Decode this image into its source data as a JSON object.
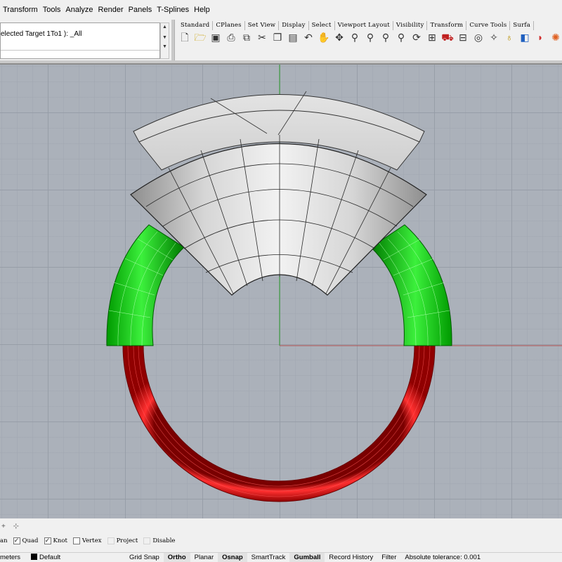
{
  "menubar": {
    "items": [
      "Transform",
      "Tools",
      "Analyze",
      "Render",
      "Panels",
      "T-Splines",
      "Help"
    ]
  },
  "command": {
    "history_text": "elected Target 1To1 ): _All"
  },
  "toolbar": {
    "tabs": [
      "Standard",
      "CPlanes",
      "Set View",
      "Display",
      "Select",
      "Viewport Layout",
      "Visibility",
      "Transform",
      "Curve Tools",
      "Surfa"
    ],
    "icons": [
      "new-file-icon",
      "open-folder-icon",
      "save-icon",
      "print-icon",
      "import-icon",
      "cut-icon",
      "copy-icon",
      "paste-icon",
      "undo-icon",
      "pan-hand-icon",
      "move-icon",
      "zoom-icon",
      "zoom-window-icon",
      "zoom-extents-icon",
      "zoom-selected-icon",
      "rotate-view-icon",
      "four-viewports-icon",
      "car-icon",
      "cplane-icon",
      "grid-icon",
      "light-icon",
      "bulb-icon",
      "layer-icon",
      "material-icon",
      "color-wheel-icon"
    ]
  },
  "osnap": {
    "items": [
      {
        "label": "an",
        "checked": null
      },
      {
        "label": "Quad",
        "checked": true
      },
      {
        "label": "Knot",
        "checked": true
      },
      {
        "label": "Vertex",
        "checked": false
      },
      {
        "label": "Project",
        "checked": false
      },
      {
        "label": "Disable",
        "checked": false
      }
    ]
  },
  "statusbar": {
    "units": "meters",
    "layer": "Default",
    "panes": [
      "Grid Snap",
      "Ortho",
      "Planar",
      "Osnap",
      "SmartTrack",
      "Gumball",
      "Record History",
      "Filter"
    ],
    "bold_panes": [
      "Ortho",
      "Osnap",
      "Gumball"
    ],
    "tolerance": "Absolute tolerance: 0.001"
  },
  "colors": {
    "shank_red": "#e01a1a",
    "shoulder_green": "#19d219",
    "head_grey": "#d2d2d2",
    "viewport_bg": "#abb1ba",
    "axis_green": "#2a9a2a",
    "axis_red": "#b05050"
  }
}
